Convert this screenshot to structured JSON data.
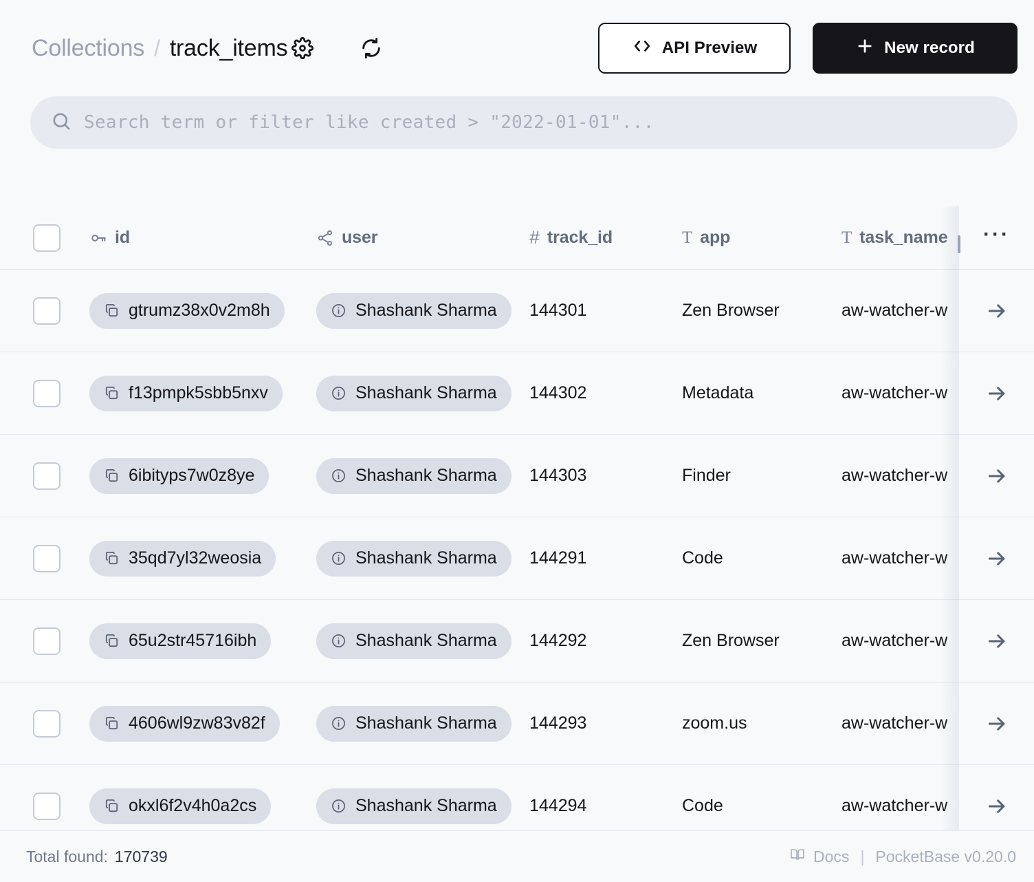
{
  "header": {
    "breadcrumb_root": "Collections",
    "breadcrumb_separator": "/",
    "breadcrumb_current": "track_items",
    "settings_icon": "gear-icon",
    "refresh_icon": "refresh-icon",
    "api_preview_label": "API Preview",
    "api_preview_icon": "code-icon",
    "new_record_label": "New record",
    "new_record_icon": "plus-icon"
  },
  "search": {
    "icon": "search-icon",
    "value": "",
    "placeholder": "Search term or filter like created > \"2022-01-01\"..."
  },
  "table": {
    "select_all_name": "select-all-checkbox",
    "overflow_menu_label": "···",
    "columns": [
      {
        "key": "id",
        "label": "id",
        "icon": "key-icon"
      },
      {
        "key": "user",
        "label": "user",
        "icon": "relation-icon"
      },
      {
        "key": "track_id",
        "label": "track_id",
        "icon": "number-icon"
      },
      {
        "key": "app",
        "label": "app",
        "icon": "text-icon"
      },
      {
        "key": "task_name",
        "label": "task_name",
        "icon": "text-icon"
      }
    ],
    "row_arrow_icon": "arrow-right-icon",
    "copy_icon": "copy-icon",
    "info_icon": "info-icon",
    "rows": [
      {
        "id": "gtrumz38x0v2m8h",
        "user": "Shashank Sharma",
        "track_id": "144301",
        "app": "Zen Browser",
        "task_name": "aw-watcher-w"
      },
      {
        "id": "f13pmpk5sbb5nxv",
        "user": "Shashank Sharma",
        "track_id": "144302",
        "app": "Metadata",
        "task_name": "aw-watcher-w"
      },
      {
        "id": "6ibityps7w0z8ye",
        "user": "Shashank Sharma",
        "track_id": "144303",
        "app": "Finder",
        "task_name": "aw-watcher-w"
      },
      {
        "id": "35qd7yl32weosia",
        "user": "Shashank Sharma",
        "track_id": "144291",
        "app": "Code",
        "task_name": "aw-watcher-w"
      },
      {
        "id": "65u2str45716ibh",
        "user": "Shashank Sharma",
        "track_id": "144292",
        "app": "Zen Browser",
        "task_name": "aw-watcher-w"
      },
      {
        "id": "4606wl9zw83v82f",
        "user": "Shashank Sharma",
        "track_id": "144293",
        "app": "zoom.us",
        "task_name": "aw-watcher-w"
      },
      {
        "id": "okxl6f2v4h0a2cs",
        "user": "Shashank Sharma",
        "track_id": "144294",
        "app": "Code",
        "task_name": "aw-watcher-w"
      }
    ]
  },
  "footer": {
    "total_label": "Total found:",
    "total_value": "170739",
    "docs_label": "Docs",
    "docs_icon": "book-icon",
    "separator": "|",
    "version": "PocketBase v0.20.0"
  },
  "colors": {
    "page_bg": "#f7f9fb",
    "accent_dark": "#16161a",
    "pill_bg": "#d9dee7",
    "search_bg": "#e7eaf0",
    "muted_text": "#737b8a",
    "border": "#e3e7ee"
  }
}
